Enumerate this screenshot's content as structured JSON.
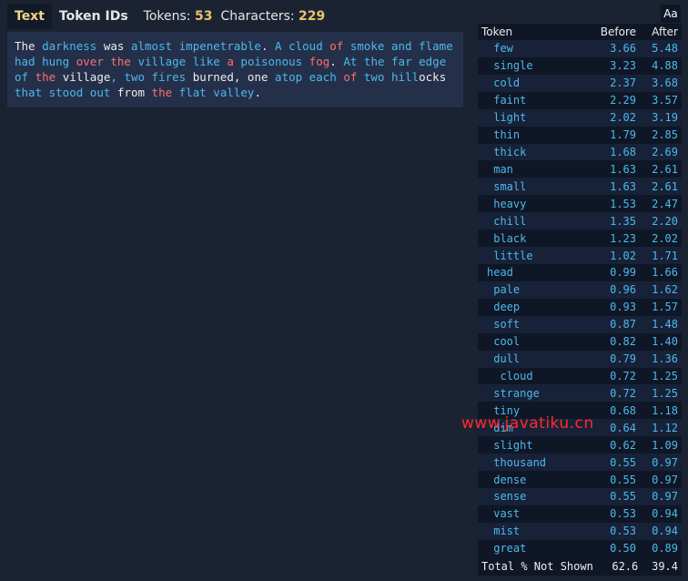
{
  "toolbar": {
    "tab_text": "Text",
    "tab_token_ids": "Token IDs",
    "tokens_label": "Tokens:",
    "tokens_value": "53",
    "characters_label": "Characters:",
    "characters_value": "229",
    "aa_label": "Aa"
  },
  "text_segments": [
    {
      "t": "The ",
      "c": "c3"
    },
    {
      "t": "darkness",
      "c": "c1"
    },
    {
      "t": " was ",
      "c": "c3"
    },
    {
      "t": "almost",
      "c": "c1"
    },
    {
      "t": " impenetrable",
      "c": "c1"
    },
    {
      "t": ". ",
      "c": "c3"
    },
    {
      "t": "A",
      "c": "c1"
    },
    {
      "t": " cloud",
      "c": "c1"
    },
    {
      "t": " of",
      "c": "c2"
    },
    {
      "t": " smoke",
      "c": "c1"
    },
    {
      "t": " and",
      "c": "c1"
    },
    {
      "t": " flame",
      "c": "c1"
    },
    {
      "t": " had",
      "c": "c1"
    },
    {
      "t": " hung",
      "c": "c1"
    },
    {
      "t": " over",
      "c": "c2"
    },
    {
      "t": " the",
      "c": "c2"
    },
    {
      "t": " village",
      "c": "c1"
    },
    {
      "t": " like",
      "c": "c1"
    },
    {
      "t": " a",
      "c": "c2"
    },
    {
      "t": " poisonous",
      "c": "c1"
    },
    {
      "t": " fog",
      "c": "c2"
    },
    {
      "t": ". ",
      "c": "c3"
    },
    {
      "t": "At",
      "c": "c1"
    },
    {
      "t": " the",
      "c": "c1"
    },
    {
      "t": " far",
      "c": "c1"
    },
    {
      "t": " edge",
      "c": "c1"
    },
    {
      "t": " of",
      "c": "c1"
    },
    {
      "t": " the",
      "c": "c2"
    },
    {
      "t": " village",
      "c": "c3"
    },
    {
      "t": ",",
      "c": "c1"
    },
    {
      "t": " two",
      "c": "c1"
    },
    {
      "t": " fires",
      "c": "c1"
    },
    {
      "t": " burned",
      "c": "c3"
    },
    {
      "t": ",",
      "c": "c3"
    },
    {
      "t": " one",
      "c": "c3"
    },
    {
      "t": " atop",
      "c": "c1"
    },
    {
      "t": " each",
      "c": "c1"
    },
    {
      "t": " of",
      "c": "c2"
    },
    {
      "t": " two",
      "c": "c1"
    },
    {
      "t": " hill",
      "c": "c1"
    },
    {
      "t": "ocks",
      "c": "c3"
    },
    {
      "t": " that",
      "c": "c1"
    },
    {
      "t": " stood",
      "c": "c1"
    },
    {
      "t": " out",
      "c": "c1"
    },
    {
      "t": " from",
      "c": "c3"
    },
    {
      "t": " the",
      "c": "c2"
    },
    {
      "t": " flat",
      "c": "c1"
    },
    {
      "t": " valley",
      "c": "c1"
    },
    {
      "t": ".",
      "c": "c3"
    }
  ],
  "table": {
    "headers": [
      "Token",
      "Before",
      "After"
    ],
    "rows": [
      {
        "token": " few",
        "before": "3.66",
        "after": "5.48"
      },
      {
        "token": " single",
        "before": "3.23",
        "after": "4.88"
      },
      {
        "token": " cold",
        "before": "2.37",
        "after": "3.68"
      },
      {
        "token": " faint",
        "before": "2.29",
        "after": "3.57"
      },
      {
        "token": " light",
        "before": "2.02",
        "after": "3.19"
      },
      {
        "token": " thin",
        "before": "1.79",
        "after": "2.85"
      },
      {
        "token": " thick",
        "before": "1.68",
        "after": "2.69"
      },
      {
        "token": " man",
        "before": "1.63",
        "after": "2.61"
      },
      {
        "token": " small",
        "before": "1.63",
        "after": "2.61"
      },
      {
        "token": " heavy",
        "before": "1.53",
        "after": "2.47"
      },
      {
        "token": " chill",
        "before": "1.35",
        "after": "2.20"
      },
      {
        "token": " black",
        "before": "1.23",
        "after": "2.02"
      },
      {
        "token": " little",
        "before": "1.02",
        "after": "1.71"
      },
      {
        "token": "head",
        "before": "0.99",
        "after": "1.66"
      },
      {
        "token": " pale",
        "before": "0.96",
        "after": "1.62"
      },
      {
        "token": " deep",
        "before": "0.93",
        "after": "1.57"
      },
      {
        "token": " soft",
        "before": "0.87",
        "after": "1.48"
      },
      {
        "token": " cool",
        "before": "0.82",
        "after": "1.40"
      },
      {
        "token": " dull",
        "before": "0.79",
        "after": "1.36"
      },
      {
        "token": "  cloud",
        "before": "0.72",
        "after": "1.25"
      },
      {
        "token": " strange",
        "before": "0.72",
        "after": "1.25"
      },
      {
        "token": " tiny",
        "before": "0.68",
        "after": "1.18"
      },
      {
        "token": " dim",
        "before": "0.64",
        "after": "1.12"
      },
      {
        "token": " slight",
        "before": "0.62",
        "after": "1.09"
      },
      {
        "token": " thousand",
        "before": "0.55",
        "after": "0.97"
      },
      {
        "token": " dense",
        "before": "0.55",
        "after": "0.97"
      },
      {
        "token": " sense",
        "before": "0.55",
        "after": "0.97"
      },
      {
        "token": " vast",
        "before": "0.53",
        "after": "0.94"
      },
      {
        "token": " mist",
        "before": "0.53",
        "after": "0.94"
      },
      {
        "token": " great",
        "before": "0.50",
        "after": "0.89"
      }
    ],
    "footer": {
      "label": "Total % Not Shown",
      "before": "62.6",
      "after": "39.4"
    }
  },
  "watermark": "www.javatiku.cn",
  "colors": {
    "background": "#1b2333",
    "token_blue": "#4db8ec",
    "token_red": "#ff6e6e",
    "accent_yellow": "#e7c56b"
  }
}
